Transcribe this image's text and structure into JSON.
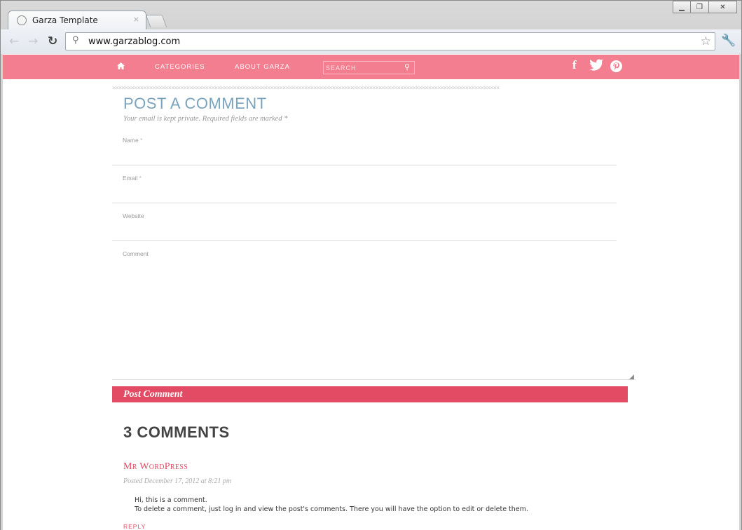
{
  "browser": {
    "tab_title": "Garza Template",
    "tab_close": "×",
    "url": "www.garzablog.com",
    "window_controls": [
      "minimize",
      "maximize",
      "close"
    ],
    "icons": [
      "back-icon",
      "forward-icon",
      "reload-icon",
      "search-icon",
      "star-icon",
      "wrench-icon"
    ]
  },
  "site_nav": {
    "home_icon": "home-icon",
    "links": [
      "CATEGORIES",
      "ABOUT GARZA"
    ],
    "search_placeholder": "SEARCH",
    "social": [
      "facebook-icon",
      "twitter-icon",
      "pinterest-icon"
    ],
    "bg_color": "#f27e8f"
  },
  "comment_form": {
    "title": "POST A COMMENT",
    "notes": "Your email is kept private. Required fields are marked",
    "required_mark": "*",
    "fields": {
      "name_label": "Name",
      "email_label": "Email",
      "website_label": "Website",
      "comment_label": "Comment"
    },
    "submit_label": "Post Comment",
    "accent_color": "#e24b63"
  },
  "comments": {
    "heading": "3 COMMENTS",
    "items": [
      {
        "author": "Mr WordPress",
        "posted": "Posted December 17, 2012 at 8:21 pm",
        "line1": "Hi, this is a comment.",
        "line2": "To delete a comment, just log in and view the post's comments. There you will have the option to edit or delete them.",
        "reply": "REPLY"
      }
    ]
  }
}
